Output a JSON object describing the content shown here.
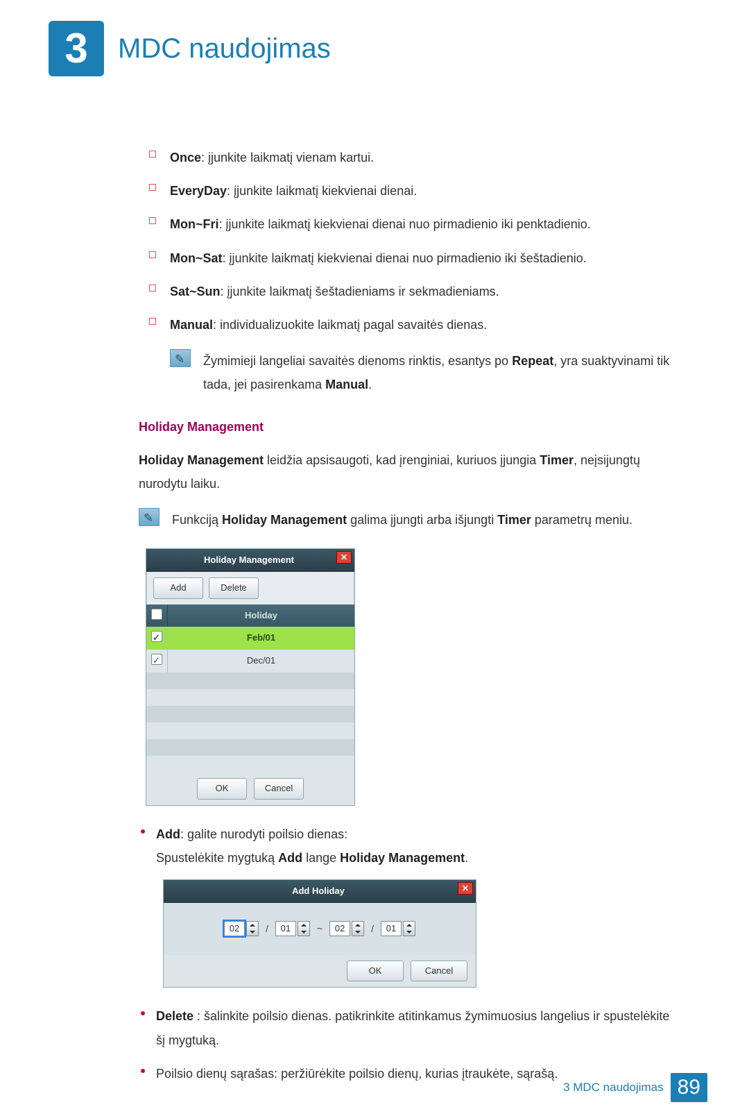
{
  "chapter": {
    "number": "3",
    "title": "MDC naudojimas"
  },
  "repeat_options": [
    {
      "term": "Once",
      "desc": ": įjunkite laikmatį vienam kartui."
    },
    {
      "term": "EveryDay",
      "desc": ": įjunkite laikmatį kiekvienai dienai."
    },
    {
      "term": "Mon~Fri",
      "desc": ": įjunkite laikmatį kiekvienai dienai nuo pirmadienio iki penktadienio."
    },
    {
      "term": "Mon~Sat",
      "desc": ": įjunkite laikmatį kiekvienai dienai nuo pirmadienio iki šeštadienio."
    },
    {
      "term": "Sat~Sun",
      "desc": ": įjunkite laikmatį šeštadieniams ir sekmadieniams."
    },
    {
      "term": "Manual",
      "desc": ": individualizuokite laikmatį pagal savaitės dienas."
    }
  ],
  "note1_pre": "Žymimieji langeliai savaitės dienoms rinktis, esantys po ",
  "note1_bold1": "Repeat",
  "note1_mid": ", yra suaktyvinami tik tada, jei pasirenkama ",
  "note1_bold2": "Manual",
  "note1_end": ".",
  "hm_heading": "Holiday Management",
  "hm_intro_bold": "Holiday Management",
  "hm_intro_text1": " leidžia apsisaugoti, kad įrenginiai, kuriuos įjungia ",
  "hm_intro_bold2": "Timer",
  "hm_intro_text2": ", neįsijungtų nurodytu laiku.",
  "note2_pre": "Funkciją ",
  "note2_b1": "Holiday Management",
  "note2_mid": " galima įjungti arba išjungti ",
  "note2_b2": "Timer",
  "note2_end": " parametrų meniu.",
  "dialog_hm": {
    "title": "Holiday Management",
    "add": "Add",
    "delete": "Delete",
    "col_holiday": "Holiday",
    "rows": [
      {
        "checked": true,
        "label": "Feb/01",
        "selected": true
      },
      {
        "checked": true,
        "label": "Dec/01",
        "selected": false
      }
    ],
    "ok": "OK",
    "cancel": "Cancel"
  },
  "add_bullet_term": "Add",
  "add_bullet_text": ": galite nurodyti poilsio dienas:",
  "add_bullet_line2a": "Spustelėkite mygtuką ",
  "add_bullet_line2b": "Add",
  "add_bullet_line2c": " lange ",
  "add_bullet_line2d": "Holiday Management",
  "add_bullet_line2e": ".",
  "dialog_ah": {
    "title": "Add Holiday",
    "vals": {
      "m1": "02",
      "d1": "01",
      "m2": "02",
      "d2": "01"
    },
    "ok": "OK",
    "cancel": "Cancel"
  },
  "delete_bullet_term": "Delete",
  "delete_bullet_text": " : šalinkite poilsio dienas. patikrinkite atitinkamus žymimuosius langelius ir spustelėkite šį mygtuką.",
  "list_bullet3": "Poilsio dienų sąrašas: peržiūrėkite poilsio dienų, kurias įtraukėte, sąrašą.",
  "footer": {
    "chapter": "3 MDC naudojimas",
    "page": "89"
  }
}
